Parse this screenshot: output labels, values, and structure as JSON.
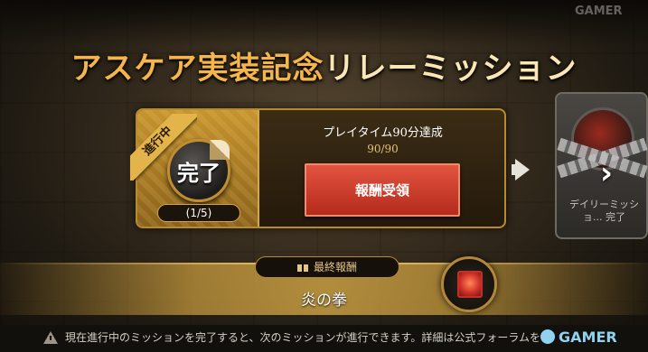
{
  "title": {
    "main": "アスケア実装記念",
    "accent": "リレーミッション"
  },
  "current_mission": {
    "ribbon": "進行中",
    "badge": "完了",
    "step": "(1/5)",
    "name": "プレイタイム90分達成",
    "progress": "90/90",
    "claim_label": "報酬受領"
  },
  "next_mission": {
    "text": "デイリーミッショ... 完了",
    "nav_icon": "chevron-right-icon"
  },
  "final_reward": {
    "label": "最終報酬",
    "name": "炎の拳",
    "icon": "fist-icon"
  },
  "notice": {
    "text": "現在進行中のミッションを完了すると、次のミッションが進行できます。詳細は公式フォーラムをご"
  },
  "watermark": {
    "bottom": "GAMER",
    "top": "GAMER"
  },
  "colors": {
    "title_gold": "#f4b64a",
    "claim_red": "#d9412d",
    "frame_gold": "#b88a2f"
  }
}
